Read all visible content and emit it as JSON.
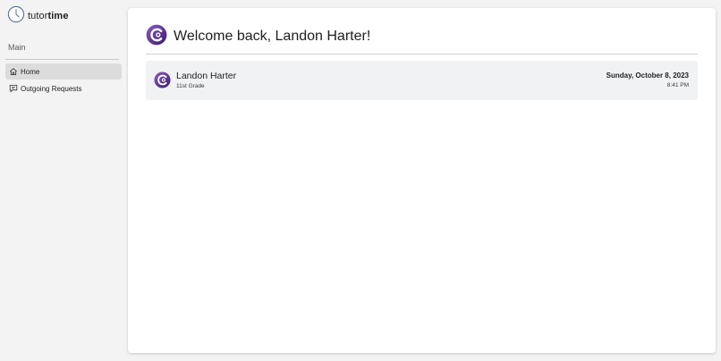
{
  "brand": {
    "prefix": "tutor",
    "suffix": "time",
    "icon": "clock-icon"
  },
  "sidebar": {
    "section_label": "Main",
    "items": [
      {
        "label": "Home",
        "icon": "home-icon",
        "active": true
      },
      {
        "label": "Outgoing Requests",
        "icon": "message-icon",
        "active": false
      }
    ]
  },
  "main": {
    "welcome_title": "Welcome back, Landon Harter!",
    "profile": {
      "name": "Landon Harter",
      "grade": "11st Grade",
      "date": "Sunday, October 8, 2023",
      "time": "8:41 PM"
    }
  },
  "colors": {
    "accent": "#5b2b8f",
    "accent_light": "#8a5cc7",
    "active_nav": "#dcdcdc",
    "card_bg": "#f1f2f4"
  }
}
